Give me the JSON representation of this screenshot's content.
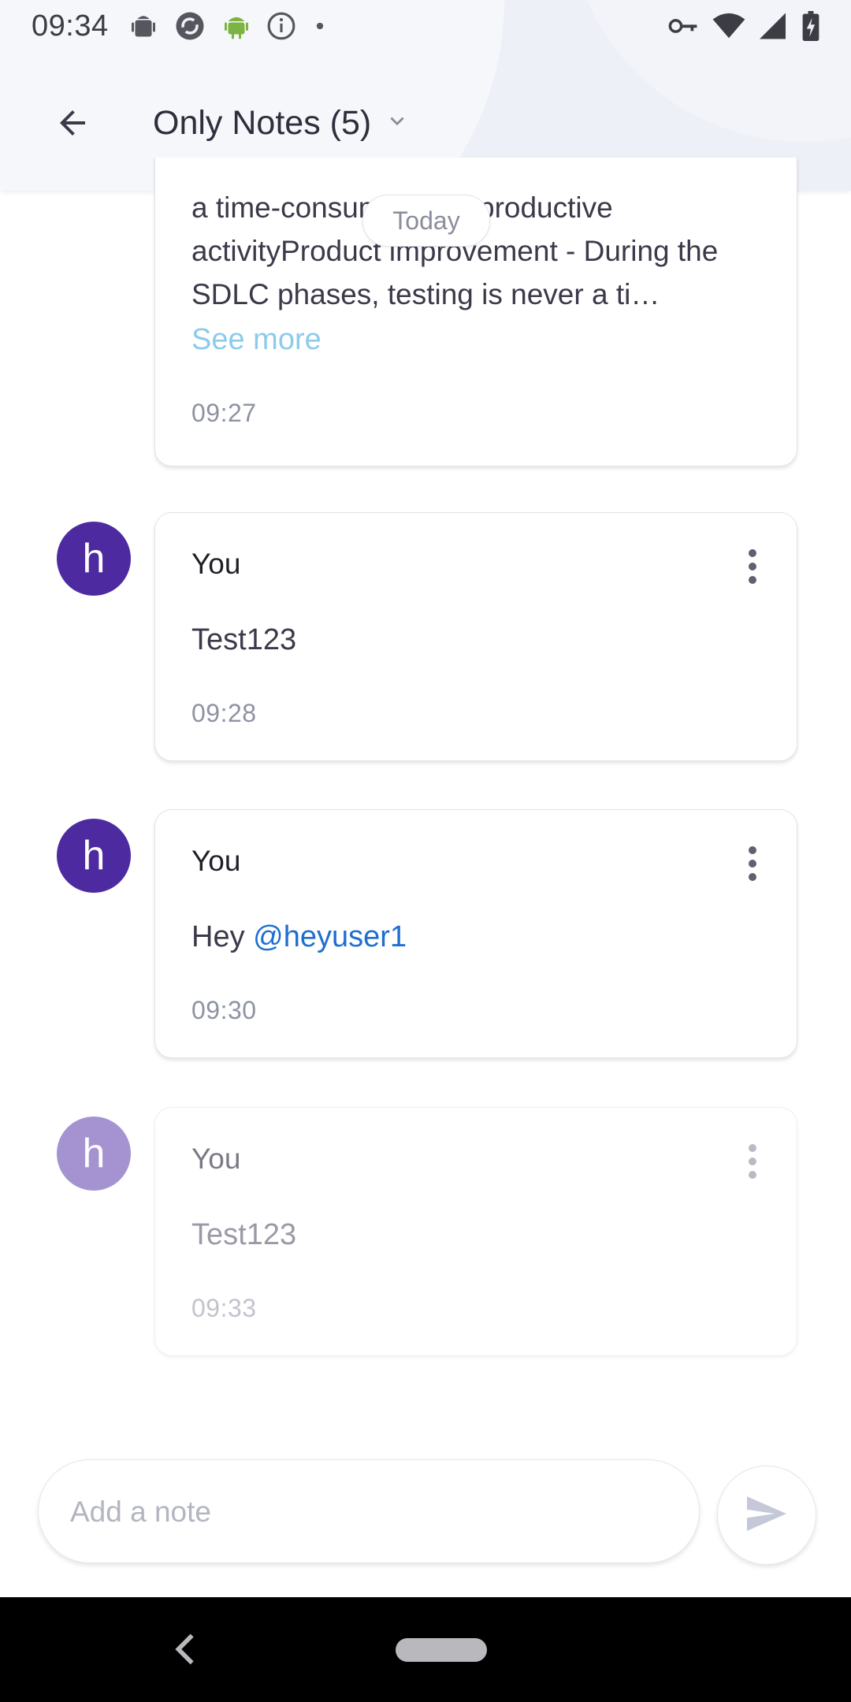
{
  "status_bar": {
    "time": "09:34",
    "left_icons": [
      "android-debug-icon",
      "sync-icon",
      "android-icon",
      "info-icon",
      "dot-icon"
    ],
    "right_icons": [
      "vpn-key-icon",
      "wifi-icon",
      "signal-icon",
      "battery-charging-icon"
    ]
  },
  "header": {
    "title": "Only Notes (5)",
    "back_icon": "arrow-left-icon",
    "dropdown_icon": "chevron-down-icon"
  },
  "date_divider": "Today",
  "notes": [
    {
      "author": "",
      "text": "a time-consuming but productive activityProduct improvement - During the SDLC phases, testing is never a ti…",
      "see_more": "See more",
      "time": "09:27",
      "faded": false
    },
    {
      "avatar_letter": "h",
      "author": "You",
      "text": "Test123",
      "time": "09:28",
      "faded": false
    },
    {
      "avatar_letter": "h",
      "author": "You",
      "text_prefix": "Hey ",
      "mention": "@heyuser1",
      "time": "09:30",
      "faded": false
    },
    {
      "avatar_letter": "h",
      "author": "You",
      "text": "Test123",
      "time": "09:33",
      "faded": true
    }
  ],
  "composer": {
    "placeholder": "Add a note",
    "value": "",
    "send_icon": "send-icon"
  },
  "colors": {
    "avatar": "#4e2aa0",
    "avatar_faded": "#a593d1",
    "mention": "#1e6fd0",
    "see_more": "#8ccbea"
  }
}
